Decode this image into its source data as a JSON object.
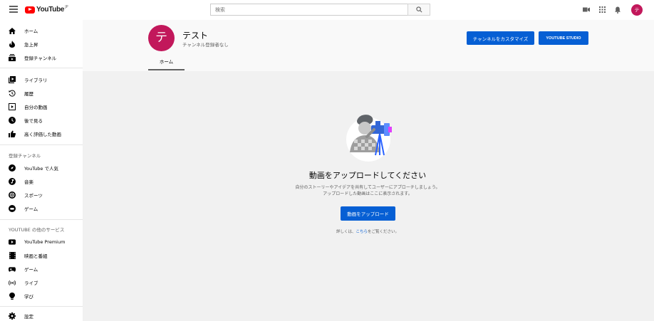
{
  "header": {
    "logo_text": "YouTube",
    "logo_suffix": "JP",
    "search_placeholder": "検索",
    "avatar_initial": "テ"
  },
  "sidebar": {
    "main": [
      {
        "label": "ホーム",
        "icon": "home-icon"
      },
      {
        "label": "急上昇",
        "icon": "trending-icon"
      },
      {
        "label": "登録チャンネル",
        "icon": "subscriptions-icon"
      }
    ],
    "library": [
      {
        "label": "ライブラリ",
        "icon": "library-icon"
      },
      {
        "label": "履歴",
        "icon": "history-icon"
      },
      {
        "label": "自分の動画",
        "icon": "your-videos-icon"
      },
      {
        "label": "後で見る",
        "icon": "watch-later-icon"
      },
      {
        "label": "高く評価した動画",
        "icon": "liked-videos-icon"
      }
    ],
    "subscriptions_title": "登録チャンネル",
    "subscriptions": [
      {
        "label": "YouTube で人気",
        "icon": "youtube-popular-icon"
      },
      {
        "label": "音楽",
        "icon": "music-icon"
      },
      {
        "label": "スポーツ",
        "icon": "sports-icon"
      },
      {
        "label": "ゲーム",
        "icon": "gaming-icon"
      }
    ],
    "more_title": "YOUTUBE の他のサービス",
    "more": [
      {
        "label": "YouTube Premium",
        "icon": "youtube-premium-icon"
      },
      {
        "label": "映画と番組",
        "icon": "movies-icon"
      },
      {
        "label": "ゲーム",
        "icon": "gaming-controller-icon"
      },
      {
        "label": "ライブ",
        "icon": "live-icon"
      },
      {
        "label": "学び",
        "icon": "learning-icon"
      }
    ],
    "settings_label": "設定"
  },
  "channel": {
    "avatar_initial": "テ",
    "name": "テスト",
    "subscribers": "チャンネル登録者なし",
    "customize_label": "チャンネルをカスタマイズ",
    "studio_label": "YOUTUBE STUDIO",
    "tab_home": "ホーム"
  },
  "empty_state": {
    "title": "動画をアップロードしてください",
    "desc_line1": "自分のストーリーやアイデアを共有してユーザーにアプローチしましょう。",
    "desc_line2": "アップロードした動画はここに表示されます。",
    "upload_label": "動画をアップロード",
    "help_prefix": "詳しくは、",
    "help_link": "こちら",
    "help_suffix": "をご覧ください。"
  },
  "colors": {
    "accent": "#065fd4",
    "avatar": "#c2185b",
    "logo_red": "#ff0000"
  }
}
